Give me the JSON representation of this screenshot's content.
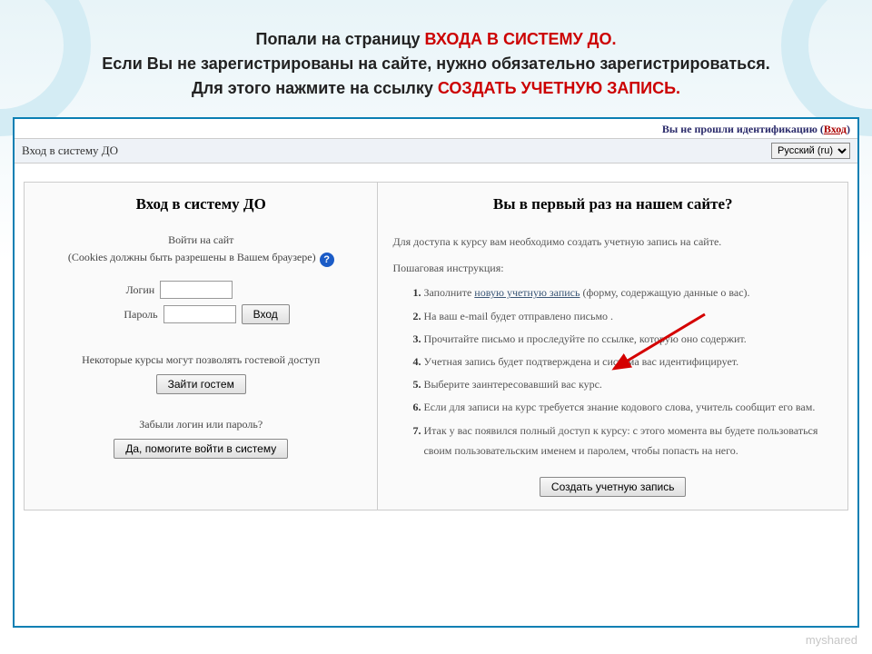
{
  "heading": {
    "line1_plain": "Попали на страницу ",
    "line1_red": "ВХОДА В СИСТЕМУ ДО.",
    "line2": "Если Вы не зарегистрированы на сайте, нужно обязательно зарегистрироваться.",
    "line3_plain": "Для этого нажмите на ссылку ",
    "line3_red": "СОЗДАТЬ УЧЕТНУЮ ЗАПИСЬ."
  },
  "auth_strip": {
    "text_prefix": "Вы не прошли идентификацию (",
    "login_link": "Вход",
    "text_suffix": ")"
  },
  "breadcrumb": "Вход в систему ДО",
  "language_selected": "Русский (ru)",
  "login_panel": {
    "title": "Вход в систему ДО",
    "enter_site": "Войти на сайт",
    "cookies_note": "(Cookies должны быть разрешены в Вашем браузере)",
    "login_label": "Логин",
    "password_label": "Пароль",
    "submit_btn": "Вход",
    "guest_note": "Некоторые курсы могут позволять гостевой доступ",
    "guest_btn": "Зайти гостем",
    "forgot_note": "Забыли логин или пароль?",
    "forgot_btn": "Да, помогите войти в систему"
  },
  "signup_panel": {
    "title": "Вы в первый раз на нашем сайте?",
    "intro": "Для доступа к курсу вам необходимо создать учетную запись на сайте.",
    "steps_header": "Пошаговая инструкция:",
    "step1_prefix": "Заполните ",
    "step1_link": "новую учетную запись",
    "step1_suffix": " (форму, содержащую данные о вас).",
    "step2": "На ваш e-mail будет отправлено письмо .",
    "step3": "Прочитайте письмо и проследуйте по ссылке, которую оно содержит.",
    "step4": "Учетная запись будет подтверждена и система вас идентифицирует.",
    "step5": "Выберите заинтересовавший вас курс.",
    "step6": "Если для записи на курс требуется знание кодового слова, учитель сообщит его вам.",
    "step7": "Итак у вас появился полный доступ к курсу: с этого момента вы будете пользоваться своим пользовательским именем и паролем, чтобы попасть на него.",
    "create_btn": "Создать учетную запись"
  },
  "footer_tag": "myshared"
}
